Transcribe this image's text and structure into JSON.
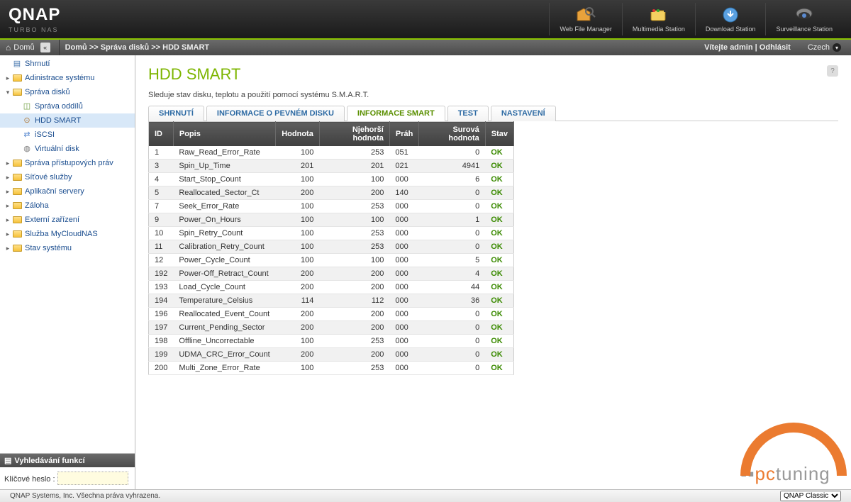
{
  "header": {
    "brand": "QNAP",
    "sub": "TURBO NAS",
    "icons": [
      {
        "label": "Web File Manager"
      },
      {
        "label": "Multimedia Station"
      },
      {
        "label": "Download Station"
      },
      {
        "label": "Surveillance Station"
      }
    ]
  },
  "bcbar": {
    "home": "Domů",
    "crumbs": "Domů >> Správa disků >> HDD SMART",
    "welcome": "Vítejte admin",
    "logout": "Odhlásit",
    "lang": "Czech"
  },
  "sidebar": {
    "items": [
      {
        "label": "Shrnutí",
        "icon": "summary",
        "lvl": 0
      },
      {
        "label": "Adinistrace systému",
        "icon": "folder",
        "lvl": 0,
        "arr": "▸"
      },
      {
        "label": "Správa disků",
        "icon": "folder-open",
        "lvl": 0,
        "arr": "▾"
      },
      {
        "label": "Správa oddílů",
        "icon": "vol",
        "lvl": 1
      },
      {
        "label": "HDD SMART",
        "icon": "hdd",
        "lvl": 1,
        "sel": true
      },
      {
        "label": "iSCSI",
        "icon": "iscsi",
        "lvl": 1
      },
      {
        "label": "Virtuální disk",
        "icon": "vdisk",
        "lvl": 1
      },
      {
        "label": "Správa přístupových práv",
        "icon": "folder",
        "lvl": 0,
        "arr": "▸"
      },
      {
        "label": "Síťové služby",
        "icon": "folder",
        "lvl": 0,
        "arr": "▸"
      },
      {
        "label": "Aplikační servery",
        "icon": "folder",
        "lvl": 0,
        "arr": "▸"
      },
      {
        "label": "Záloha",
        "icon": "folder",
        "lvl": 0,
        "arr": "▸"
      },
      {
        "label": "Externí zařízení",
        "icon": "folder",
        "lvl": 0,
        "arr": "▸"
      },
      {
        "label": "Služba MyCloudNAS",
        "icon": "folder",
        "lvl": 0,
        "arr": "▸"
      },
      {
        "label": "Stav systému",
        "icon": "folder",
        "lvl": 0,
        "arr": "▸"
      }
    ],
    "search_hdr": "Vyhledávání funkcí",
    "search_label": "Klíčové heslo :"
  },
  "page": {
    "title": "HDD SMART",
    "desc": "Sleduje stav disku, teplotu a použití pomocí systému S.M.A.R.T.",
    "tabs": [
      "SHRNUTÍ",
      "INFORMACE O PEVNÉM DISKU",
      "INFORMACE SMART",
      "TEST",
      "NASTAVENÍ"
    ],
    "active_tab": 2
  },
  "table": {
    "headers": [
      "ID",
      "Popis",
      "Hodnota",
      "Njehorší hodnota",
      "Práh",
      "Surová hodnota",
      "Stav"
    ],
    "rows": [
      {
        "id": "1",
        "desc": "Raw_Read_Error_Rate",
        "val": "100",
        "worst": "253",
        "thr": "051",
        "raw": "0",
        "st": "OK"
      },
      {
        "id": "3",
        "desc": "Spin_Up_Time",
        "val": "201",
        "worst": "201",
        "thr": "021",
        "raw": "4941",
        "st": "OK"
      },
      {
        "id": "4",
        "desc": "Start_Stop_Count",
        "val": "100",
        "worst": "100",
        "thr": "000",
        "raw": "6",
        "st": "OK"
      },
      {
        "id": "5",
        "desc": "Reallocated_Sector_Ct",
        "val": "200",
        "worst": "200",
        "thr": "140",
        "raw": "0",
        "st": "OK"
      },
      {
        "id": "7",
        "desc": "Seek_Error_Rate",
        "val": "100",
        "worst": "253",
        "thr": "000",
        "raw": "0",
        "st": "OK"
      },
      {
        "id": "9",
        "desc": "Power_On_Hours",
        "val": "100",
        "worst": "100",
        "thr": "000",
        "raw": "1",
        "st": "OK"
      },
      {
        "id": "10",
        "desc": "Spin_Retry_Count",
        "val": "100",
        "worst": "253",
        "thr": "000",
        "raw": "0",
        "st": "OK"
      },
      {
        "id": "11",
        "desc": "Calibration_Retry_Count",
        "val": "100",
        "worst": "253",
        "thr": "000",
        "raw": "0",
        "st": "OK"
      },
      {
        "id": "12",
        "desc": "Power_Cycle_Count",
        "val": "100",
        "worst": "100",
        "thr": "000",
        "raw": "5",
        "st": "OK"
      },
      {
        "id": "192",
        "desc": "Power-Off_Retract_Count",
        "val": "200",
        "worst": "200",
        "thr": "000",
        "raw": "4",
        "st": "OK"
      },
      {
        "id": "193",
        "desc": "Load_Cycle_Count",
        "val": "200",
        "worst": "200",
        "thr": "000",
        "raw": "44",
        "st": "OK"
      },
      {
        "id": "194",
        "desc": "Temperature_Celsius",
        "val": "114",
        "worst": "112",
        "thr": "000",
        "raw": "36",
        "st": "OK"
      },
      {
        "id": "196",
        "desc": "Reallocated_Event_Count",
        "val": "200",
        "worst": "200",
        "thr": "000",
        "raw": "0",
        "st": "OK"
      },
      {
        "id": "197",
        "desc": "Current_Pending_Sector",
        "val": "200",
        "worst": "200",
        "thr": "000",
        "raw": "0",
        "st": "OK"
      },
      {
        "id": "198",
        "desc": "Offline_Uncorrectable",
        "val": "100",
        "worst": "253",
        "thr": "000",
        "raw": "0",
        "st": "OK"
      },
      {
        "id": "199",
        "desc": "UDMA_CRC_Error_Count",
        "val": "200",
        "worst": "200",
        "thr": "000",
        "raw": "0",
        "st": "OK"
      },
      {
        "id": "200",
        "desc": "Multi_Zone_Error_Rate",
        "val": "100",
        "worst": "253",
        "thr": "000",
        "raw": "0",
        "st": "OK"
      }
    ]
  },
  "footer": {
    "copyright": "QNAP Systems, Inc. Všechna práva vyhrazena.",
    "theme": "QNAP Classic"
  },
  "watermark": "pctuning"
}
